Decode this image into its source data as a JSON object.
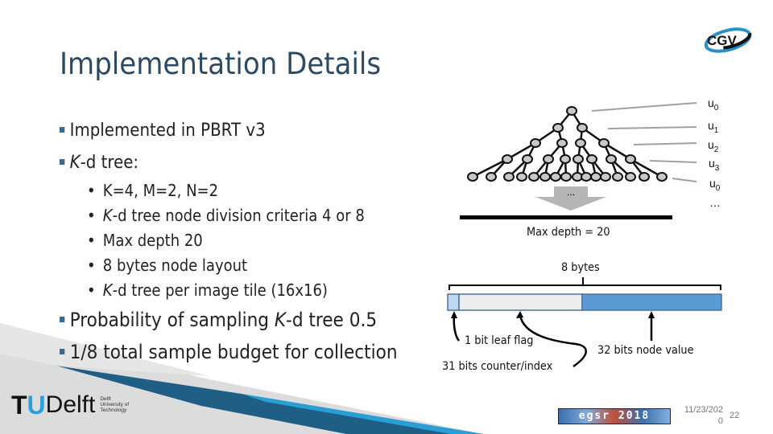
{
  "slide": {
    "title": "Implementation Details",
    "bullets": [
      {
        "text": "Implemented in PBRT v3"
      },
      {
        "italic": "K",
        "text": "-d tree:"
      }
    ],
    "sub_bullets": [
      {
        "marker": "•",
        "text": "K=4, M=2, N=2"
      },
      {
        "marker": "•",
        "italic": "K",
        "text": "-d tree node division criteria 4 or 8"
      },
      {
        "marker": "•",
        "text": "Max depth 20"
      },
      {
        "marker": "•",
        "text": "8 bytes node layout"
      },
      {
        "marker": "•",
        "italic": "K",
        "text": "-d tree per image tile (16x16)"
      }
    ],
    "bullets_lower": [
      {
        "pre": "Probability of sampling ",
        "italic": "K",
        "post": "-d tree 0.5"
      },
      {
        "text": "1/8 total sample budget for collection"
      }
    ]
  },
  "diagram": {
    "level_labels": [
      {
        "base": "u",
        "sub": "0"
      },
      {
        "base": "u",
        "sub": "1"
      },
      {
        "base": "u",
        "sub": "2"
      },
      {
        "base": "u",
        "sub": "3"
      },
      {
        "base": "u",
        "sub": "0"
      },
      {
        "base": "…",
        "sub": ""
      }
    ],
    "arrow_label": "...",
    "max_depth_label": "Max depth = 20",
    "bytes_label": "8 bytes",
    "leaf_flag_label": "1 bit leaf flag",
    "counter_label": "31 bits counter/index",
    "node_value_label": "32 bits node value",
    "colors": {
      "leaf_flag": "#bdd7ee",
      "counter": "#ececec",
      "node_value": "#5b9bd5",
      "node": "#c8c8c8"
    }
  },
  "footer": {
    "date_line1": "11/23/202",
    "date_line2": "0",
    "page": "22",
    "tudelft": {
      "main": "TUDelft",
      "t": "T",
      "u": "U",
      "delft": "Delft",
      "sub1": "Delft",
      "sub2": "University of",
      "sub3": "Technology"
    },
    "cgv_logo": "CGV",
    "egsr_logo": "egsr 2018"
  }
}
